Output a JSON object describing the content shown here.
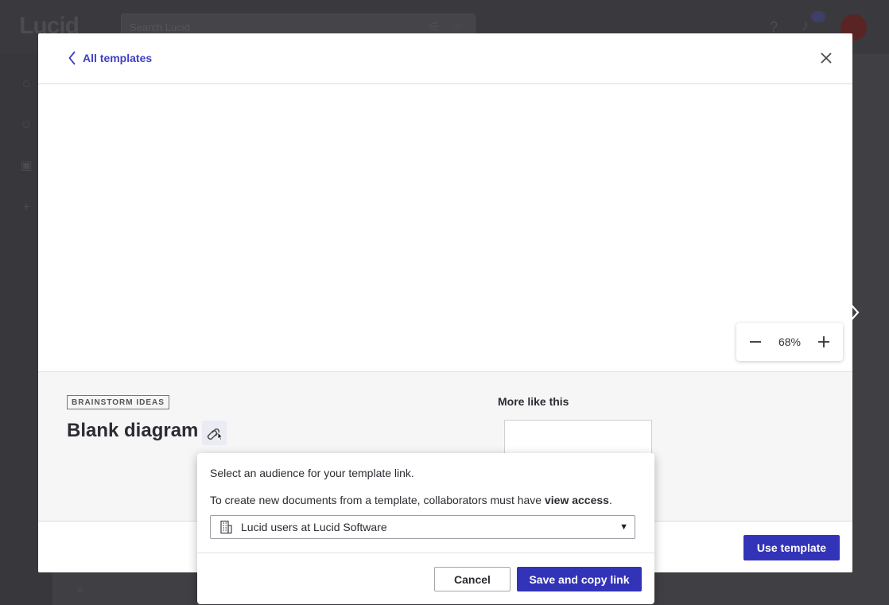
{
  "background_app": {
    "logo": "Lucid",
    "search_placeholder": "Search Lucid"
  },
  "modal": {
    "back_label": "All templates",
    "zoom_level": "68%",
    "category_tag": "BRAINSTORM IDEAS",
    "template_title": "Blank diagram",
    "more_like_this": "More like this",
    "use_template_label": "Use template"
  },
  "share_popover": {
    "prompt": "Select an audience for your template link.",
    "note_prefix": "To create new documents from a template, collaborators must have ",
    "note_bold": "view access",
    "note_suffix": ".",
    "audience_selected": "Lucid users at Lucid Software",
    "cancel_label": "Cancel",
    "save_label": "Save and copy link"
  },
  "colors": {
    "accent": "#3333b8",
    "link": "#3f3fc2"
  }
}
